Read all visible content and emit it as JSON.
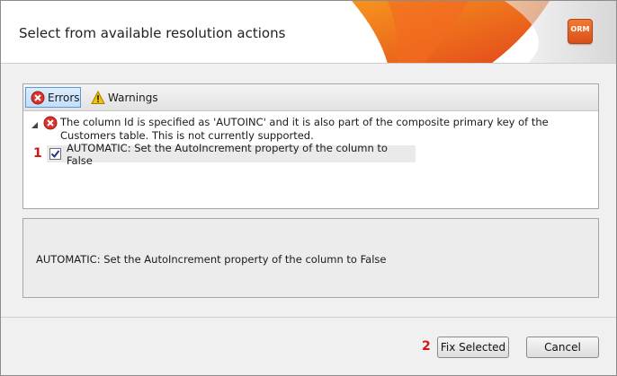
{
  "dialog": {
    "title": "Select from available resolution actions",
    "logo_text": "ORM"
  },
  "filters": {
    "errors_label": "Errors",
    "warnings_label": "Warnings"
  },
  "error_item": {
    "message": "The column Id is specified as 'AUTOINC' and it is also part of the composite primary key of the Customers table. This is not currently supported.",
    "action": {
      "label": "AUTOMATIC: Set the AutoIncrement property of the column to False",
      "checked": true
    }
  },
  "details": {
    "text": "AUTOMATIC: Set the AutoIncrement property of the column to False"
  },
  "markers": {
    "action_marker": "1",
    "fix_marker": "2"
  },
  "buttons": {
    "fix_selected": "Fix Selected",
    "cancel": "Cancel"
  },
  "colors": {
    "accent_orange": "#f26a21",
    "error_red": "#d9342b",
    "warning_yellow": "#f4c20d",
    "marker_red": "#d11414",
    "selected_blue": "#5b9bd5"
  }
}
